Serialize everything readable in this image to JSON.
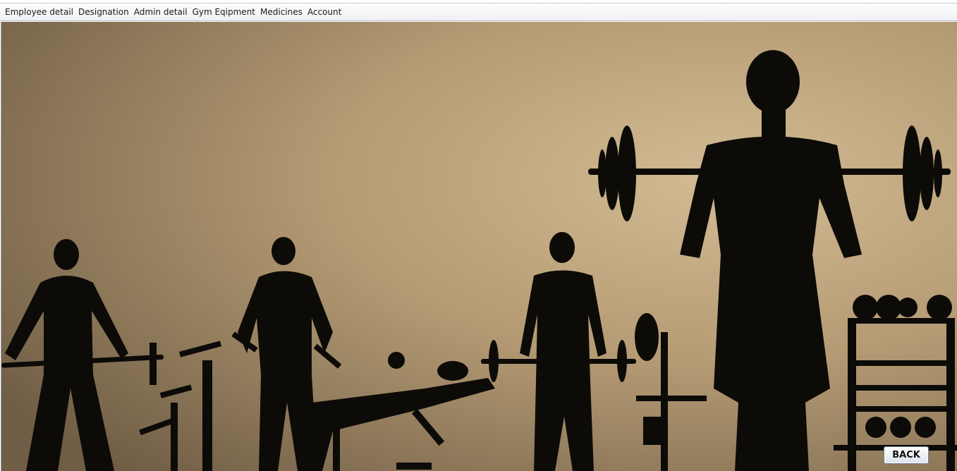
{
  "menubar": {
    "items": [
      {
        "label": "Employee detail"
      },
      {
        "label": "Designation"
      },
      {
        "label": "Admin detail"
      },
      {
        "label": "Gym Eqipment"
      },
      {
        "label": "Medicines"
      },
      {
        "label": "Account"
      }
    ]
  },
  "background": {
    "description_icon": "gym-silhouette-image",
    "colors": {
      "light": "#c8b08a",
      "mid": "#a88e69",
      "dark": "#6e5d45",
      "silhouette": "#0d0b08"
    }
  },
  "back_button": {
    "label": "BACK"
  }
}
